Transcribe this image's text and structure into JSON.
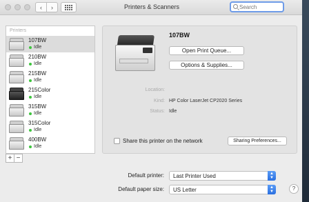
{
  "window": {
    "title": "Printers & Scanners"
  },
  "toolbar": {
    "back": "‹",
    "forward": "›"
  },
  "search": {
    "placeholder": "Search"
  },
  "sidebar": {
    "header": "Printers",
    "items": [
      {
        "name": "107BW",
        "status": "Idle",
        "selected": true,
        "icon": "laser-printer-icon"
      },
      {
        "name": "210BW",
        "status": "Idle",
        "icon": "laser-printer-icon"
      },
      {
        "name": "215BW",
        "status": "Idle",
        "icon": "laser-printer-icon"
      },
      {
        "name": "215Color",
        "status": "Idle",
        "icon": "color-printer-icon",
        "dark": true
      },
      {
        "name": "315BW",
        "status": "Idle",
        "icon": "laser-printer-icon"
      },
      {
        "name": "315Color",
        "status": "Idle",
        "icon": "color-printer-icon"
      },
      {
        "name": "400BW",
        "status": "Idle",
        "icon": "laser-printer-icon"
      }
    ],
    "add": "+",
    "remove": "−"
  },
  "detail": {
    "printer_name": "107BW",
    "open_queue": "Open Print Queue...",
    "options": "Options & Supplies...",
    "location_label": "Location:",
    "location_value": "",
    "kind_label": "Kind:",
    "kind_value": "HP Color LaserJet CP2020 Series",
    "status_label": "Status:",
    "status_value": "Idle",
    "share_label": "Share this printer on the network",
    "share_checked": false,
    "sharing_prefs": "Sharing Preferences..."
  },
  "defaults": {
    "printer_label": "Default printer:",
    "printer_value": "Last Printer Used",
    "paper_label": "Default paper size:",
    "paper_value": "US Letter"
  },
  "colors": {
    "idle_dot": "#3ec43e",
    "accent": "#2a6fe0"
  },
  "help": "?"
}
